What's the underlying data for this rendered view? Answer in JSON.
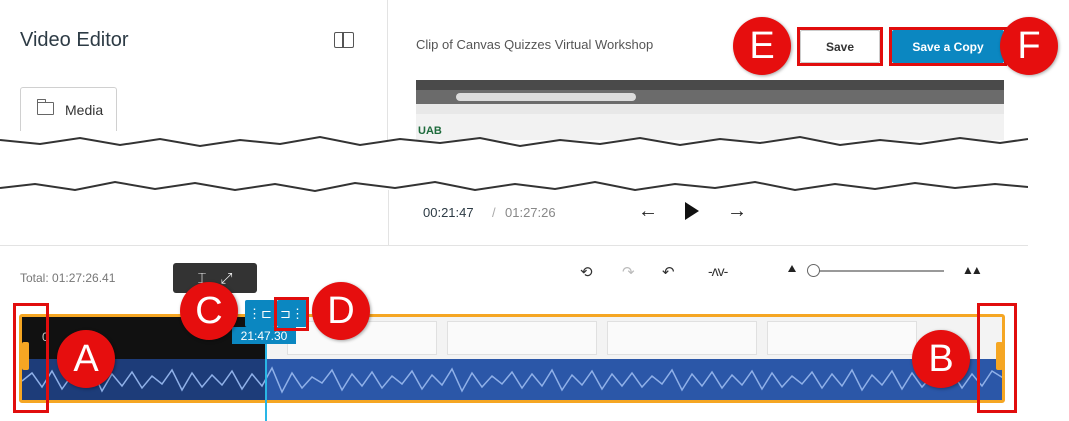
{
  "app": {
    "title": "Video Editor",
    "media_tab": "Media"
  },
  "clip": {
    "title": "Clip of Canvas Quizzes Virtual Workshop",
    "preview_logo": "UAB"
  },
  "header_buttons": {
    "save": "Save",
    "save_copy": "Save a Copy"
  },
  "player": {
    "current_time": "00:21:47",
    "separator": "/",
    "total_time": "01:27:26",
    "prev_icon": "left-arrow-icon",
    "play_icon": "play-icon",
    "next_icon": "right-arrow-icon"
  },
  "timeline": {
    "total_label": "Total: 01:27:26.41",
    "tooltip_icons": [
      "trim-icon",
      "expand-icon"
    ],
    "tooltip_glyphs": [
      "⌶",
      "⤢"
    ],
    "toolbar_icons": {
      "history": "⟲",
      "redo": "↷",
      "undo": "↶",
      "waveform": "-ᴧᴠ-"
    },
    "zoom_large_glyph": "▲▲",
    "zoom_level": 0.05,
    "track_start": "0",
    "playhead_time": "21:47.30",
    "split_left_glyph": "⋮⊏",
    "split_right_glyph": "⊐⋮"
  },
  "annotations": {
    "A": "A",
    "B": "B",
    "C": "C",
    "D": "D",
    "E": "E",
    "F": "F"
  },
  "colors": {
    "accent": "#0b87c1",
    "callout": "#e60e0e",
    "track_border": "#f5a623",
    "waveform": "#2b57a8"
  }
}
